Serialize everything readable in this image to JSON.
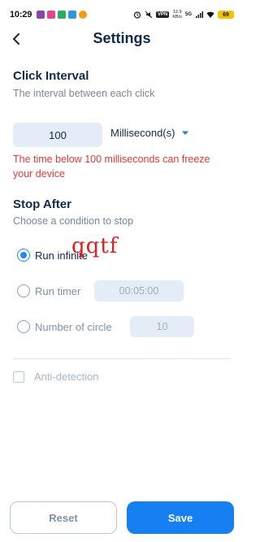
{
  "status_bar": {
    "time": "10:29",
    "vpn": "VPN",
    "net_speed_top": "12.9",
    "net_speed_bottom": "KB/s",
    "network": "5G",
    "battery": "69"
  },
  "header": {
    "title": "Settings"
  },
  "click_interval": {
    "title": "Click Interval",
    "subtitle": "The interval between each click",
    "value": "100",
    "unit": "Millisecond(s)",
    "warning": "The time below 100 milliseconds can freeze your device"
  },
  "stop_after": {
    "title": "Stop After",
    "subtitle": "Choose a condition to stop",
    "options": [
      {
        "label": "Run infinite",
        "selected": true
      },
      {
        "label": "Run timer",
        "selected": false,
        "field_value": "00:05:00"
      },
      {
        "label": "Number of circle",
        "selected": false,
        "field_value": "10"
      }
    ]
  },
  "overlay_text": "qqtf",
  "anti_detection": {
    "label": "Anti-detection",
    "checked": false
  },
  "buttons": {
    "reset": "Reset",
    "save": "Save"
  },
  "colors": {
    "accent": "#1680f3",
    "warning": "#e53935",
    "title": "#0f2a4a",
    "field_bg": "#e3ecf7"
  }
}
